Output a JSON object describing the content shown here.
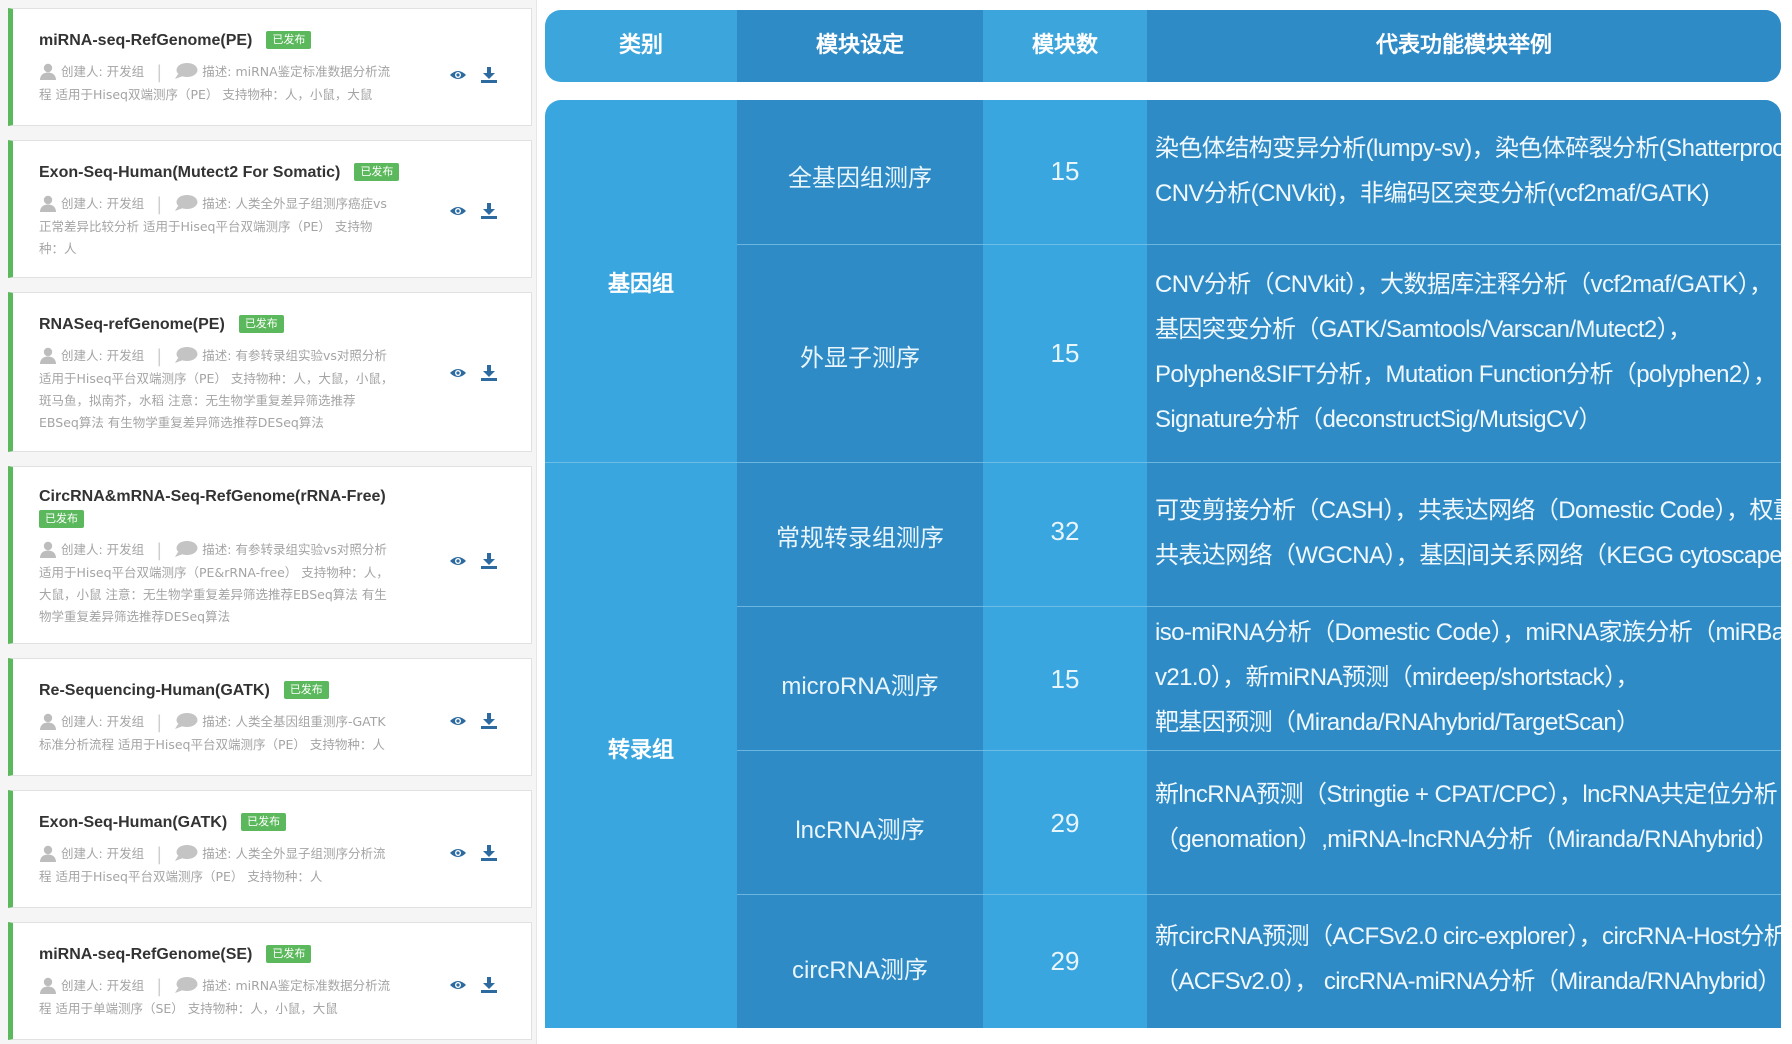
{
  "colors": {
    "badge": "#5cb85c",
    "card_accent": "#5cb85c",
    "table_light": "#3aa6df",
    "table_dark": "#2f8bc6"
  },
  "icons": {
    "creator": "user-icon",
    "description": "chat-bubble-icon",
    "view": "eye-icon",
    "download": "download-icon"
  },
  "pipelines": [
    {
      "title": "miRNA-seq-RefGenome(PE)",
      "badge": "已发布",
      "creator": "创建人: 开发组",
      "desc_lines": [
        "描述: miRNA鉴定标准数据分析流",
        "程 适用于Hiseq双端测序（PE） 支持物种：人，小鼠，大鼠"
      ]
    },
    {
      "title": "Exon-Seq-Human(Mutect2 For Somatic)",
      "badge": "已发布",
      "creator": "创建人: 开发组",
      "desc_lines": [
        "描述: 人类全外显子组测序癌症vs",
        "正常差异比较分析 适用于Hiseq平台双端测序（PE） 支持物",
        "种：人"
      ]
    },
    {
      "title": "RNASeq-refGenome(PE)",
      "badge": "已发布",
      "creator": "创建人: 开发组",
      "desc_lines": [
        "描述: 有参转录组实验vs对照分析",
        "适用于Hiseq平台双端测序（PE） 支持物种：人，大鼠，小鼠，",
        "斑马鱼，拟南芥，水稻 注意：无生物学重复差异筛选推荐",
        "EBSeq算法 有生物学重复差异筛选推荐DESeq算法"
      ]
    },
    {
      "title": "CircRNA&mRNA-Seq-RefGenome(rRNA-Free)",
      "badge": "已发布",
      "creator": "创建人: 开发组",
      "desc_lines": [
        "描述: 有参转录组实验vs对照分析",
        "适用于Hiseq平台双端测序（PE&rRNA-free） 支持物种：人，",
        "大鼠，小鼠 注意：无生物学重复差异筛选推荐EBSeq算法 有生",
        "物学重复差异筛选推荐DESeq算法"
      ]
    },
    {
      "title": "Re-Sequencing-Human(GATK)",
      "badge": "已发布",
      "creator": "创建人: 开发组",
      "desc_lines": [
        "描述: 人类全基因组重测序-GATK",
        "标准分析流程 适用于Hiseq平台双端测序（PE） 支持物种：人"
      ]
    },
    {
      "title": "Exon-Seq-Human(GATK)",
      "badge": "已发布",
      "creator": "创建人: 开发组",
      "desc_lines": [
        "描述: 人类全外显子组测序分析流",
        "程 适用于Hiseq平台双端测序（PE） 支持物种：人"
      ]
    },
    {
      "title": "miRNA-seq-RefGenome(SE)",
      "badge": "已发布",
      "creator": "创建人: 开发组",
      "desc_lines": [
        "描述: miRNA鉴定标准数据分析流",
        "程 适用于单端测序（SE） 支持物种：人，小鼠，大鼠"
      ]
    }
  ],
  "table": {
    "headers": [
      "类别",
      "模块设定",
      "模块数",
      "代表功能模块举例"
    ],
    "categories": [
      "基因组",
      "转录组"
    ],
    "rows": [
      {
        "module": "全基因组测序",
        "count": "15",
        "example_lines": [
          "染色体结构变异分析(lumpy-sv)，染色体碎裂分析(Shatterproof)，",
          "CNV分析(CNVkit)，非编码区突变分析(vcf2maf/GATK)"
        ]
      },
      {
        "module": "外显子测序",
        "count": "15",
        "example_lines": [
          "CNV分析（CNVkit），大数据库注释分析（vcf2maf/GATK），",
          "基因突变分析（GATK/Samtools/Varscan/Mutect2），",
          "Polyphen&SIFT分析，Mutation Function分析（polyphen2），",
          "Signature分析（deconstructSig/MutsigCV）"
        ]
      },
      {
        "module": "常规转录组测序",
        "count": "32",
        "example_lines": [
          "可变剪接分析（CASH），共表达网络（Domestic Code），权重",
          "共表达网络（WGCNA），基因间关系网络（KEGG cytoscape）"
        ]
      },
      {
        "module": "microRNA测序",
        "count": "15",
        "example_lines": [
          "iso-miRNA分析（Domestic Code），miRNA家族分析（miRBase",
          "v21.0），新miRNA预测（mirdeep/shortstack），",
          "靶基因预测（Miranda/RNAhybrid/TargetScan）"
        ]
      },
      {
        "module": "lncRNA测序",
        "count": "29",
        "example_lines": [
          "新lncRNA预测（Stringtie + CPAT/CPC），lncRNA共定位分析",
          "（genomation）,miRNA-lncRNA分析（Miranda/RNAhybrid）"
        ]
      },
      {
        "module": "circRNA测序",
        "count": "29",
        "example_lines": [
          "新circRNA预测（ACFSv2.0 circ-explorer），circRNA-Host分析",
          "（ACFSv2.0）， circRNA-miRNA分析（Miranda/RNAhybrid）"
        ]
      }
    ]
  }
}
